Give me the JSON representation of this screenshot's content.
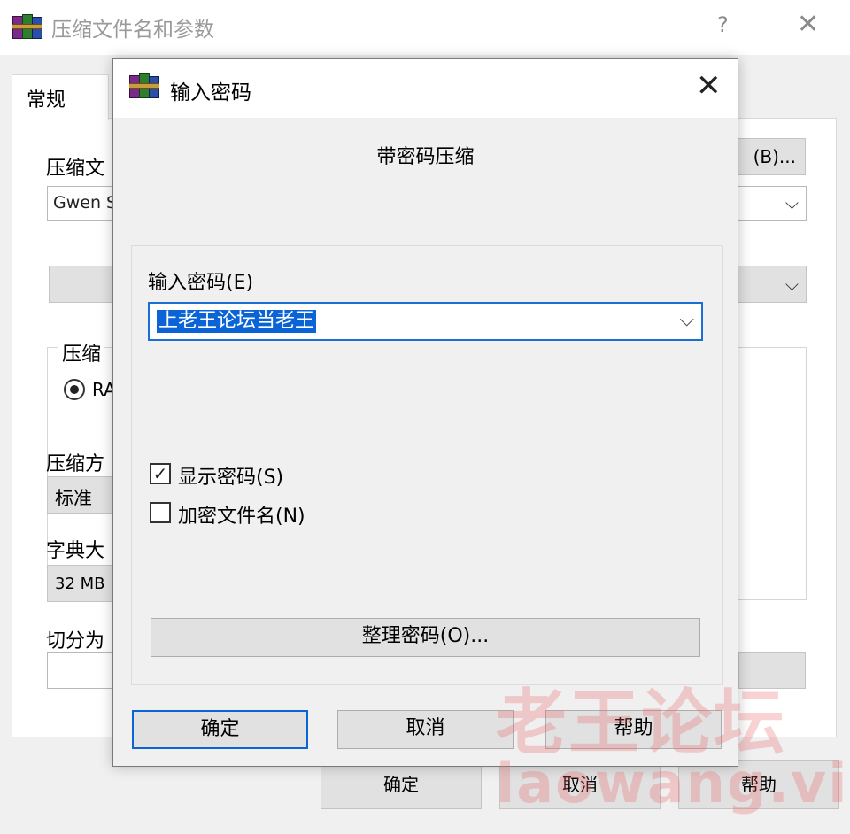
{
  "background_window": {
    "title": "压缩文件名和参数",
    "help_glyph": "?",
    "close_glyph": "✕",
    "tab_general": "常规",
    "archive_name_label": "压缩文",
    "archive_name_value": "Gwen S",
    "browse_button": "(B)...",
    "archive_format_group_title": "压缩",
    "format_rar_label": "RA",
    "compression_method_label": "压缩方",
    "compression_method_value": "标准",
    "dictionary_size_label": "字典大",
    "dictionary_size_value": "32 MB",
    "split_label": "切分为",
    "ok_button": "确定",
    "cancel_button": "取消",
    "help_button": "帮助"
  },
  "dialog": {
    "title": "输入密码",
    "close_glyph": "✕",
    "heading": "带密码压缩",
    "password_label": "输入密码(E)",
    "password_value": "上老王论坛当老王",
    "dropdown_glyph": "⌵",
    "show_password": {
      "label": "显示密码(S)",
      "checked": true,
      "check_glyph": "✓"
    },
    "encrypt_filenames": {
      "label": "加密文件名(N)",
      "checked": false
    },
    "organize_button": "整理密码(O)...",
    "ok_button": "确定",
    "cancel_button": "取消",
    "help_button": "帮助"
  },
  "watermark": {
    "line1": "老王论坛",
    "line2": "laowang.vip"
  },
  "colors": {
    "accent": "#0a64d6",
    "window_bg": "#f0f0f0",
    "button_bg": "#e1e1e1",
    "watermark": "#e86060"
  },
  "icons": [
    "winrar-icon",
    "close-icon",
    "help-icon",
    "chevron-down-icon",
    "checkbox-checked-icon",
    "radio-selected-icon"
  ]
}
